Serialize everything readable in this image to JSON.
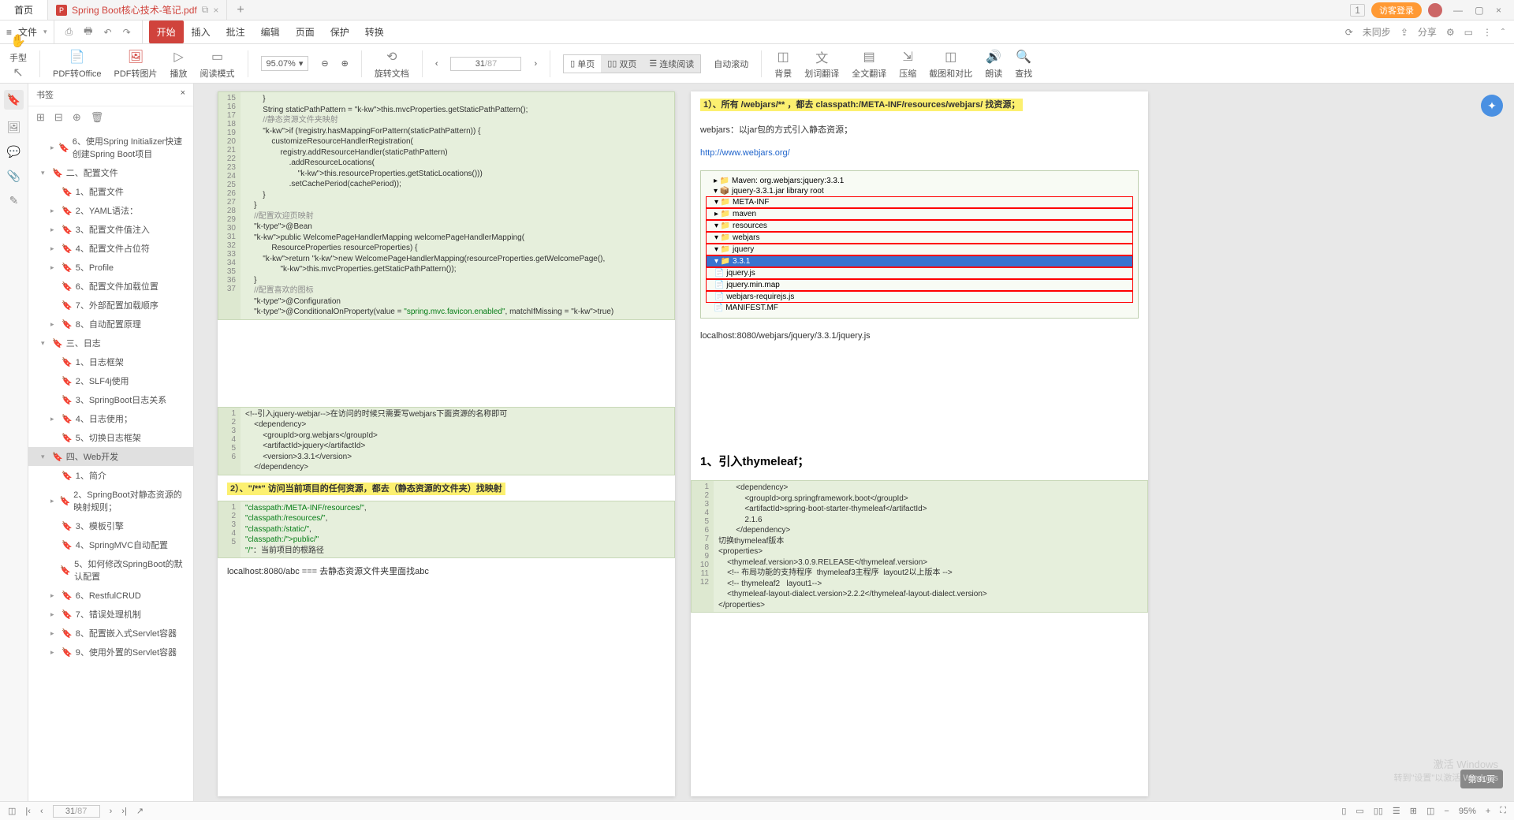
{
  "titlebar": {
    "home": "首页",
    "filename": "Spring Boot核心技术-笔记.pdf",
    "plus": "+",
    "right_badge_num": "1",
    "login_label": "访客登录"
  },
  "menubar": {
    "hamburger": "≡",
    "file": "文件",
    "tabs": [
      "开始",
      "插入",
      "批注",
      "编辑",
      "页面",
      "保护",
      "转换"
    ],
    "right_unsync": "未同步",
    "right_share": "分享"
  },
  "toolbar": {
    "hand": "手型",
    "select": "选择",
    "pdf2office": "PDF转Office",
    "pdf2img": "PDF转图片",
    "play": "播放",
    "readmode": "阅读模式",
    "zoom": "95.07%",
    "rotate": "旋转文档",
    "single": "单页",
    "double": "双页",
    "continuous": "连续阅读",
    "autoscroll": "自动滚动",
    "bg": "背景",
    "translate": "划词翻译",
    "fulltranslate": "全文翻译",
    "compress": "压缩",
    "compare": "截图和对比",
    "read": "朗读",
    "search": "查找",
    "page_cur": "31",
    "page_total": "/87"
  },
  "bookmarks": {
    "title": "书签",
    "items": [
      {
        "level": 1,
        "arrow": "▸",
        "label": "6、使用Spring Initializer快速创建Spring Boot项目"
      },
      {
        "level": 0,
        "arrow": "▾",
        "label": "二、配置文件"
      },
      {
        "level": 1,
        "arrow": "",
        "label": "1、配置文件"
      },
      {
        "level": 1,
        "arrow": "▸",
        "label": "2、YAML语法：",
        "sel": false
      },
      {
        "level": 1,
        "arrow": "▸",
        "label": "3、配置文件值注入"
      },
      {
        "level": 1,
        "arrow": "▸",
        "label": "4、配置文件占位符"
      },
      {
        "level": 1,
        "arrow": "▸",
        "label": "5、Profile"
      },
      {
        "level": 1,
        "arrow": "",
        "label": "6、配置文件加载位置"
      },
      {
        "level": 1,
        "arrow": "",
        "label": "7、外部配置加载顺序"
      },
      {
        "level": 1,
        "arrow": "▸",
        "label": "8、自动配置原理"
      },
      {
        "level": 0,
        "arrow": "▾",
        "label": "三、日志"
      },
      {
        "level": 1,
        "arrow": "",
        "label": "1、日志框架"
      },
      {
        "level": 1,
        "arrow": "",
        "label": "2、SLF4j使用"
      },
      {
        "level": 1,
        "arrow": "",
        "label": "3、SpringBoot日志关系"
      },
      {
        "level": 1,
        "arrow": "▸",
        "label": "4、日志使用；"
      },
      {
        "level": 1,
        "arrow": "",
        "label": "5、切换日志框架"
      },
      {
        "level": 0,
        "arrow": "▾",
        "label": "四、Web开发",
        "sel": true
      },
      {
        "level": 1,
        "arrow": "",
        "label": "1、简介"
      },
      {
        "level": 1,
        "arrow": "▸",
        "label": "2、SpringBoot对静态资源的映射规则；"
      },
      {
        "level": 1,
        "arrow": "",
        "label": "3、模板引擎"
      },
      {
        "level": 1,
        "arrow": "",
        "label": "4、SpringMVC自动配置"
      },
      {
        "level": 1,
        "arrow": "",
        "label": "5、如何修改SpringBoot的默认配置"
      },
      {
        "level": 1,
        "arrow": "▸",
        "label": "6、RestfulCRUD"
      },
      {
        "level": 1,
        "arrow": "▸",
        "label": "7、错误处理机制"
      },
      {
        "level": 1,
        "arrow": "▸",
        "label": "8、配置嵌入式Servlet容器"
      },
      {
        "level": 1,
        "arrow": "▸",
        "label": "9、使用外置的Servlet容器"
      }
    ]
  },
  "page_left": {
    "code1_start": 15,
    "code1": "        }\n        String staticPathPattern = this.mvcProperties.getStaticPathPattern();\n        //静态资源文件夹映射\n        if (!registry.hasMappingForPattern(staticPathPattern)) {\n            customizeResourceHandlerRegistration(\n                registry.addResourceHandler(staticPathPattern)\n                    .addResourceLocations(\n                        this.resourceProperties.getStaticLocations()))\n                    .setCachePeriod(cachePeriod));\n        }\n    }\n\n    //配置欢迎页映射\n    @Bean\n    public WelcomePageHandlerMapping welcomePageHandlerMapping(\n            ResourceProperties resourceProperties) {\n        return new WelcomePageHandlerMapping(resourceProperties.getWelcomePage(),\n                this.mvcProperties.getStaticPathPattern());\n    }\n\n    //配置喜欢的图标\n    @Configuration\n    @ConditionalOnProperty(value = \"spring.mvc.favicon.enabled\", matchIfMissing = true)",
    "code2_start": 1,
    "code2": "<!--引入jquery-webjar-->在访问的时候只需要写webjars下面资源的名称即可\n    <dependency>\n        <groupId>org.webjars</groupId>\n        <artifactId>jquery</artifactId>\n        <version>3.3.1</version>\n    </dependency>",
    "hl2": "2）、\"/**\" 访问当前项目的任何资源，都去（静态资源的文件夹）找映射",
    "code3_start": 1,
    "code3": "\"classpath:/META-INF/resources/\",\n\"classpath:/resources/\",\n\"classpath:/static/\",\n\"classpath:/public/\"\n\"/\"：当前项目的根路径",
    "foot": "localhost:8080/abc === 去静态资源文件夹里面找abc"
  },
  "page_right": {
    "hl1": "1）、所有 /webjars/** ，都去 classpath:/META-INF/resources/webjars/ 找资源；",
    "webjars_note": "webjars：以jar包的方式引入静态资源；",
    "link": "http://www.webjars.org/",
    "tree": [
      "▸ 📁 Maven: org.webjars:jquery:3.3.1",
      " ▾ 📦 jquery-3.3.1.jar  library root",
      "  ▾ 📁 META-INF",
      "   ▸ 📁 maven",
      "   ▾ 📁 resources",
      "    ▾ 📁 webjars",
      "     ▾ 📁 jquery",
      "      ▾ 📁 3.3.1",
      "        📄 jquery.js",
      "        📄 jquery.min.map",
      "        📄 webjars-requirejs.js",
      "   📄 MANIFEST.MF"
    ],
    "local_url": "localhost:8080/webjars/jquery/3.3.1/jquery.js",
    "heading": "1、引入thymeleaf；",
    "code_start": 1,
    "code": "        <dependency>\n            <groupId>org.springframework.boot</groupId>\n            <artifactId>spring-boot-starter-thymeleaf</artifactId>\n            2.1.6\n        </dependency>\n切换thymeleaf版本\n<properties>\n    <thymeleaf.version>3.0.9.RELEASE</thymeleaf.version>\n    <!-- 布局功能的支持程序  thymeleaf3主程序  layout2以上版本 -->\n    <!-- thymeleaf2   layout1-->\n    <thymeleaf-layout-dialect.version>2.2.2</thymeleaf-layout-dialect.version>\n</properties>"
  },
  "fab_page": "第31页",
  "statusbar": {
    "page_cur": "31",
    "page_total": "/87",
    "zoom": "95%"
  },
  "watermark": {
    "l1": "激活 Windows",
    "l2": "转到\"设置\"以激活 Windows"
  }
}
